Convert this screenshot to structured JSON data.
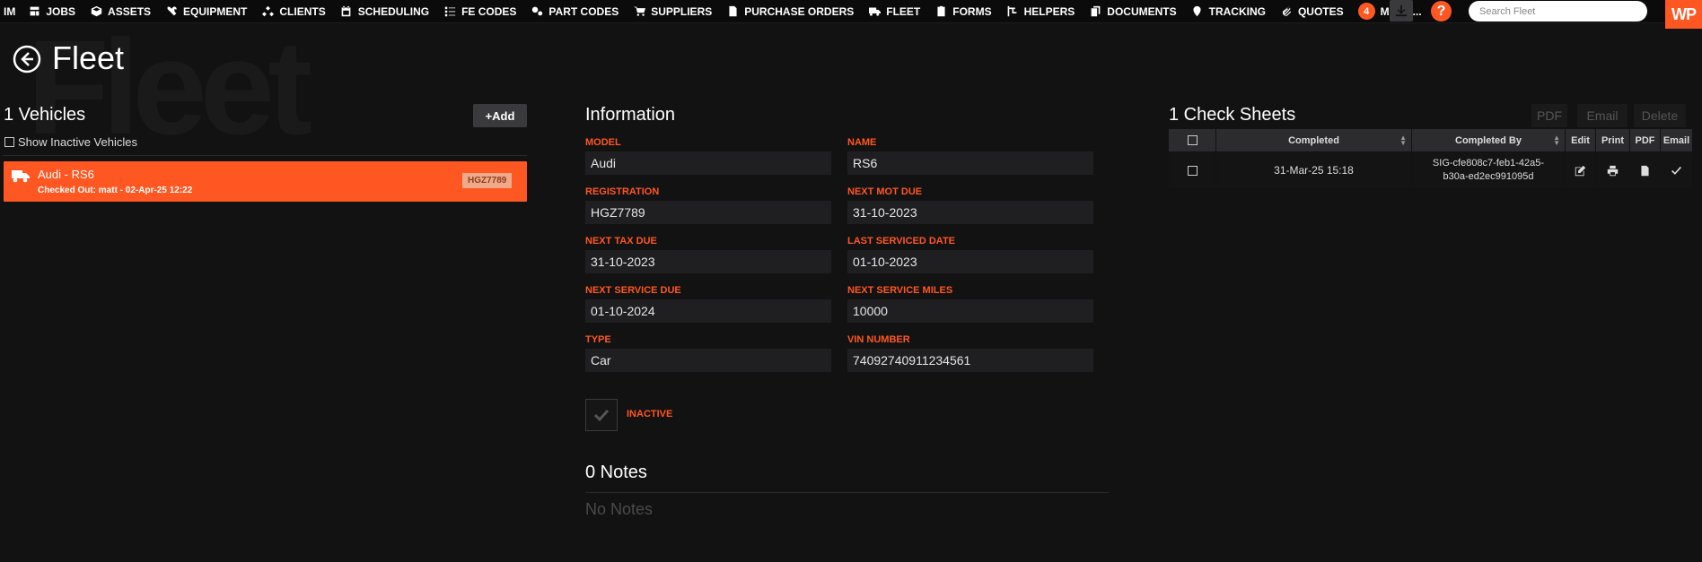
{
  "nav": {
    "items": [
      {
        "label": "IM"
      },
      {
        "label": "JOBS",
        "icon": "jobs-icon"
      },
      {
        "label": "ASSETS",
        "icon": "assets-icon"
      },
      {
        "label": "EQUIPMENT",
        "icon": "equipment-icon"
      },
      {
        "label": "CLIENTS",
        "icon": "clients-icon"
      },
      {
        "label": "SCHEDULING",
        "icon": "calendar-icon"
      },
      {
        "label": "FE CODES",
        "icon": "list-icon"
      },
      {
        "label": "PART CODES",
        "icon": "gears-icon"
      },
      {
        "label": "SUPPLIERS",
        "icon": "cart-icon"
      },
      {
        "label": "PURCHASE ORDERS",
        "icon": "document-icon"
      },
      {
        "label": "FLEET",
        "icon": "truck-icon"
      },
      {
        "label": "FORMS",
        "icon": "clipboard-icon"
      },
      {
        "label": "HELPERS",
        "icon": "helpers-icon"
      },
      {
        "label": "DOCUMENTS",
        "icon": "files-icon"
      },
      {
        "label": "TRACKING",
        "icon": "map-marker-icon"
      },
      {
        "label": "QUOTES",
        "icon": "paperclip-icon"
      }
    ],
    "more_count": "4",
    "more_label": "MORE...",
    "help_label": "?",
    "search_placeholder": "Search Fleet",
    "logo_text": "WP",
    "accent": "#ff5722"
  },
  "page": {
    "watermark": "Fleet",
    "title": "Fleet"
  },
  "vehicles": {
    "title": "1 Vehicles",
    "add_label": "+Add",
    "show_inactive_label": "Show Inactive Vehicles",
    "items": [
      {
        "name": "Audi - RS6",
        "sub": "Checked Out: matt - 02-Apr-25 12:22",
        "reg": "HGZ7789"
      }
    ]
  },
  "info": {
    "title": "Information",
    "fields": {
      "model": {
        "label": "MODEL",
        "value": "Audi"
      },
      "name": {
        "label": "NAME",
        "value": "RS6"
      },
      "registration": {
        "label": "REGISTRATION",
        "value": "HGZ7789"
      },
      "next_mot_due": {
        "label": "NEXT MOT DUE",
        "value": "31-10-2023"
      },
      "next_tax_due": {
        "label": "NEXT TAX DUE",
        "value": "31-10-2023"
      },
      "last_serviced": {
        "label": "LAST SERVICED DATE",
        "value": "01-10-2023"
      },
      "next_service_due": {
        "label": "NEXT SERVICE DUE",
        "value": "01-10-2024"
      },
      "next_service_miles": {
        "label": "NEXT SERVICE MILES",
        "value": "10000"
      },
      "type": {
        "label": "TYPE",
        "value": "Car"
      },
      "vin": {
        "label": "VIN NUMBER",
        "value": "74092740911234561"
      }
    },
    "inactive_label": "INACTIVE"
  },
  "notes": {
    "title": "0 Notes",
    "empty": "No Notes"
  },
  "checksheets": {
    "title": "1 Check Sheets",
    "pdf_label": "PDF",
    "email_label": "Email",
    "delete_label": "Delete",
    "columns": [
      "Completed",
      "Completed By",
      "Edit",
      "Print",
      "PDF",
      "Email"
    ],
    "rows": [
      {
        "completed": "31-Mar-25 15:18",
        "by": "SIG-cfe808c7-feb1-42a5-b30a-ed2ec991095d"
      }
    ]
  }
}
